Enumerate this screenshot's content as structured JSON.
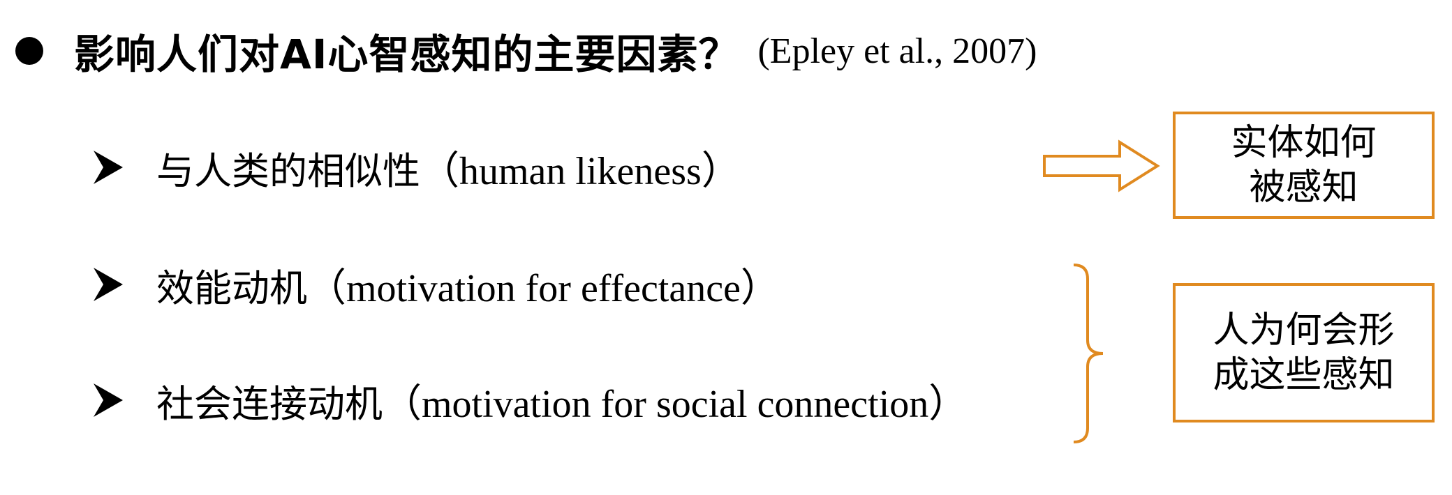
{
  "title": {
    "text": "影响人们对AI心智感知的主要因素？",
    "citation": "(Epley et al., 2007)"
  },
  "bullets": [
    {
      "zh": "与人类的相似性",
      "en": "（human likeness）"
    },
    {
      "zh": "效能动机",
      "en": "（motivation for effectance）"
    },
    {
      "zh": "社会连接动机",
      "en": "（motivation for social connection）"
    }
  ],
  "boxes": [
    {
      "line1": "实体如何",
      "line2": "被感知"
    },
    {
      "line1": "人为何会形",
      "line2": "成这些感知"
    }
  ],
  "colors": {
    "accent": "#E08A20",
    "text": "#000000",
    "background": "#ffffff"
  },
  "icons": {
    "bullet_marker": "disc-bullet-icon",
    "list_marker": "arrowhead-bullet-icon",
    "connector_1": "hollow-right-arrow-icon",
    "connector_2": "right-curly-brace-icon"
  }
}
